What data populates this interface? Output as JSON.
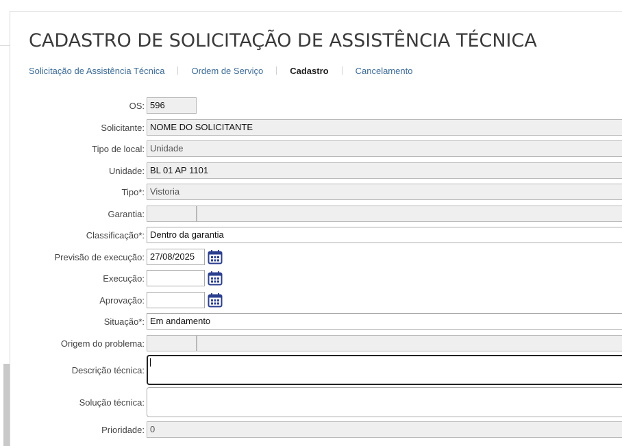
{
  "page": {
    "title": "CADASTRO DE SOLICITAÇÃO DE ASSISTÊNCIA TÉCNICA"
  },
  "tabs": [
    {
      "label": "Solicitação de Assistência Técnica",
      "active": false
    },
    {
      "label": "Ordem de Serviço",
      "active": false
    },
    {
      "label": "Cadastro",
      "active": true
    },
    {
      "label": "Cancelamento",
      "active": false
    }
  ],
  "form": {
    "os": {
      "label": "OS:",
      "value": "596"
    },
    "solicitante": {
      "label": "Solicitante:",
      "value": "NOME DO SOLICITANTE"
    },
    "tipo_local": {
      "label": "Tipo de local:",
      "value": "Unidade"
    },
    "unidade": {
      "label": "Unidade:",
      "value": "BL 01 AP 1101"
    },
    "tipo": {
      "label": "Tipo*:",
      "value": "Vistoria"
    },
    "garantia": {
      "label": "Garantia:",
      "code": "",
      "value": ""
    },
    "classificacao": {
      "label": "Classificação*:",
      "value": "Dentro da garantia"
    },
    "previsao": {
      "label": "Previsão de execução:",
      "value": "27/08/2025"
    },
    "execucao": {
      "label": "Execução:",
      "value": ""
    },
    "aprovacao": {
      "label": "Aprovação:",
      "value": ""
    },
    "situacao": {
      "label": "Situação*:",
      "value": "Em andamento"
    },
    "origem": {
      "label": "Origem do problema:",
      "code": "",
      "value": ""
    },
    "descricao": {
      "label": "Descrição técnica:",
      "value": ""
    },
    "solucao": {
      "label": "Solução técnica:",
      "value": ""
    },
    "prioridade": {
      "label": "Prioridade:",
      "value": "0"
    }
  },
  "icons": {
    "calendar": "calendar-icon"
  },
  "colors": {
    "link": "#3d6b96",
    "calendar": "#2b3f8f"
  }
}
